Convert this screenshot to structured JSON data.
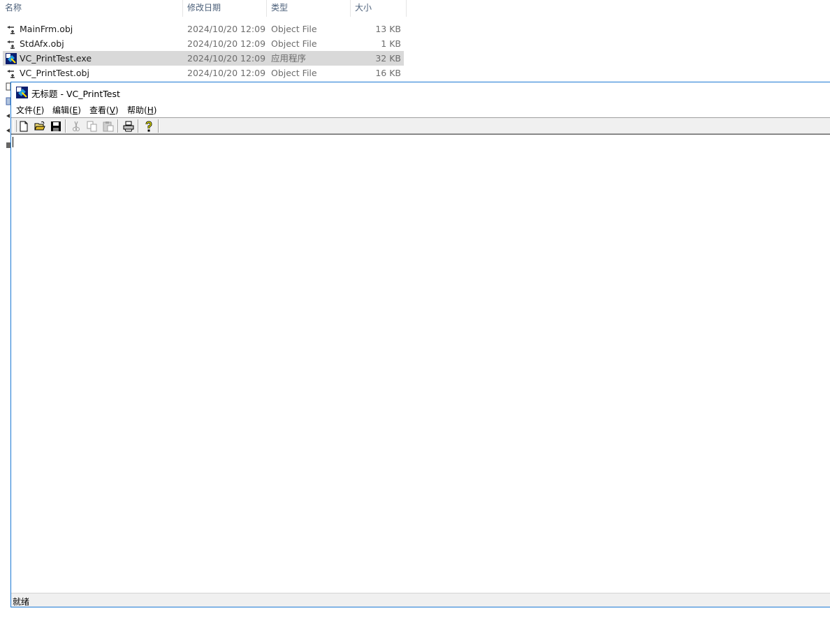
{
  "explorer": {
    "columns": [
      "名称",
      "修改日期",
      "类型",
      "大小"
    ],
    "files": [
      {
        "name": "MainFrm.obj",
        "date": "2024/10/20 12:09",
        "type": "Object File",
        "size": "13 KB",
        "icon": "object-file-icon"
      },
      {
        "name": "StdAfx.obj",
        "date": "2024/10/20 12:09",
        "type": "Object File",
        "size": "1 KB",
        "icon": "object-file-icon"
      },
      {
        "name": "VC_PrintTest.exe",
        "date": "2024/10/20 12:09",
        "type": "应用程序",
        "size": "32 KB",
        "icon": "mfc-app-icon",
        "selected": true
      },
      {
        "name": "VC_PrintTest.obj",
        "date": "2024/10/20 12:09",
        "type": "Object File",
        "size": "16 KB",
        "icon": "object-file-icon"
      }
    ]
  },
  "app": {
    "title": "无标题 - VC_PrintTest",
    "menu": [
      {
        "label": "文件(",
        "mnemonic": "F",
        "close": ")"
      },
      {
        "label": "编辑(",
        "mnemonic": "E",
        "close": ")"
      },
      {
        "label": "查看(",
        "mnemonic": "V",
        "close": ")"
      },
      {
        "label": "帮助(",
        "mnemonic": "H",
        "close": ")"
      }
    ],
    "toolbar": [
      "new-icon",
      "open-icon",
      "save-icon",
      "cut-icon",
      "copy-icon",
      "paste-icon",
      "print-icon",
      "help-icon"
    ],
    "status": "就绪",
    "accent": "#1c78d4"
  }
}
